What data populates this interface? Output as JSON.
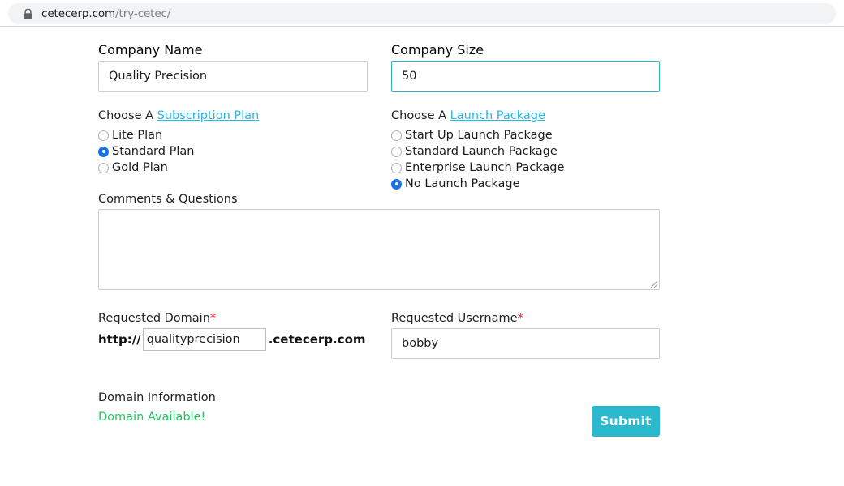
{
  "browser": {
    "lock_icon": "lock-icon",
    "url_host": "cetecerp.com",
    "url_path": "/try-cetec/"
  },
  "form": {
    "company_name": {
      "label": "Company Name",
      "value": "Quality Precision",
      "placeholder": ""
    },
    "company_size": {
      "label": "Company Size",
      "value": "50",
      "placeholder": "",
      "focused": true,
      "focus_border_color": "#2bb5c4"
    },
    "subscription": {
      "prefix": "Choose A ",
      "link_label": "Subscription Plan",
      "options": [
        {
          "label": "Lite Plan",
          "checked": false
        },
        {
          "label": "Standard Plan",
          "checked": true
        },
        {
          "label": "Gold Plan",
          "checked": false
        }
      ]
    },
    "launch": {
      "prefix": "Choose A ",
      "link_label": "Launch Package",
      "options": [
        {
          "label": "Start Up Launch Package",
          "checked": false
        },
        {
          "label": "Standard Launch Package",
          "checked": false
        },
        {
          "label": "Enterprise Launch Package",
          "checked": false
        },
        {
          "label": "No Launch Package",
          "checked": true
        }
      ]
    },
    "comments": {
      "label": "Comments & Questions",
      "value": "",
      "placeholder": ""
    },
    "requested_domain": {
      "label": "Requested Domain",
      "required_mark": "*",
      "prefix": "http://",
      "value": "qualityprecision",
      "placeholder": "",
      "suffix": ".cetecerp.com"
    },
    "requested_username": {
      "label": "Requested Username",
      "required_mark": "*",
      "value": "bobby",
      "placeholder": ""
    },
    "domain_information": {
      "label": "Domain Information",
      "status": "Domain Available!",
      "status_color": "#22c55e"
    },
    "submit": {
      "label": "Submit",
      "color": "#29b8cc"
    }
  },
  "colors": {
    "link": "#25b7e8",
    "radio_selected": "#1a73e8",
    "required": "#ee1c25"
  }
}
